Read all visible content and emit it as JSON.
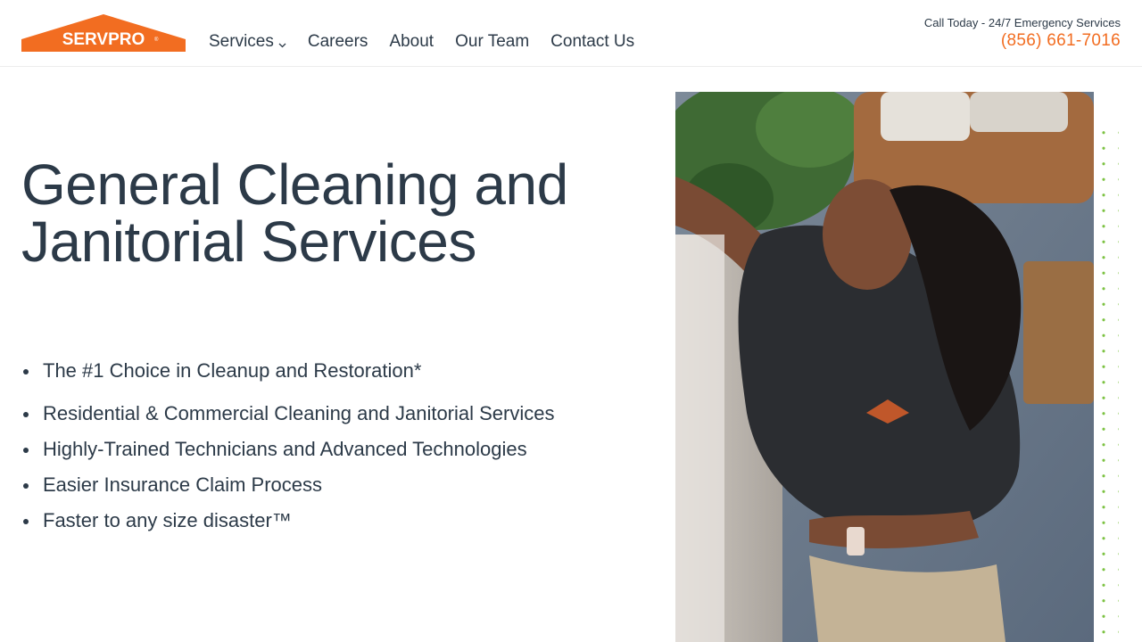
{
  "brand": {
    "name": "SERVPRO",
    "primary_color": "#f26d21",
    "text_color": "#2c3a48",
    "accent_dots_color": "#7cc242"
  },
  "nav": {
    "items": [
      {
        "label": "Services",
        "has_dropdown": true
      },
      {
        "label": "Careers"
      },
      {
        "label": "About"
      },
      {
        "label": "Our Team"
      },
      {
        "label": "Contact Us"
      }
    ]
  },
  "contact": {
    "label": "Call Today - 24/7 Emergency Services",
    "phone": "(856) 661-7016"
  },
  "hero": {
    "title": "General Cleaning and Janitorial Services",
    "bullets": [
      "The #1 Choice in Cleanup and Restoration*",
      "Residential & Commercial Cleaning and Janitorial Services",
      "Highly-Trained Technicians and Advanced Technologies",
      "Easier Insurance Claim Process",
      "Faster to any size disaster™"
    ],
    "image_icon": "technician-cleaning-photo"
  }
}
